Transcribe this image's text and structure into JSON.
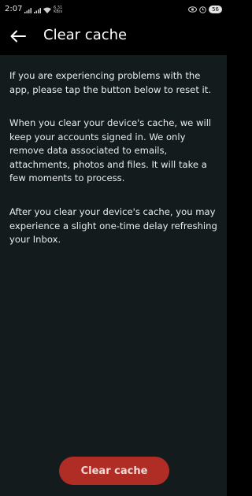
{
  "status_bar": {
    "time": "2:07",
    "net_speed": "6.31\nKB/s",
    "battery": "56",
    "icons": [
      "signal-icon",
      "signal-icon",
      "wifi-icon",
      "eye-icon",
      "alarm-icon",
      "battery-icon"
    ]
  },
  "header": {
    "back_icon": "arrow-left-icon",
    "title": "Clear cache"
  },
  "content": {
    "paragraphs": [
      "If you are experiencing problems with the app, please tap the button below to reset it.",
      "When you clear your device's cache, we will keep your accounts signed in. We only remove data associated to emails, attachments, photos and files. It will take a few moments to process.",
      "After you clear your device's cache, you may experience a slight one-time delay refreshing your Inbox."
    ]
  },
  "actions": {
    "clear_cache_label": "Clear cache"
  },
  "colors": {
    "background": "#141b1d",
    "header": "#000000",
    "button": "#b02d26",
    "button_text": "#f4d9d6"
  }
}
